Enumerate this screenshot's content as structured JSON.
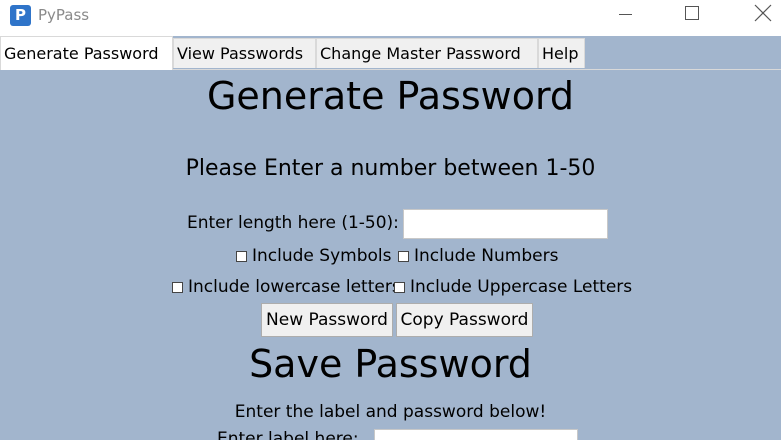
{
  "window": {
    "title": "PyPass",
    "icon_letter": "P",
    "icon_color": "#2f74c9",
    "background": "#a2b5cd",
    "controls": [
      "minimize-icon",
      "maximize-icon",
      "close-icon"
    ]
  },
  "tabs": [
    {
      "label": "Generate Password",
      "selected": true
    },
    {
      "label": "View Passwords",
      "selected": false
    },
    {
      "label": "Change Master Password",
      "selected": false
    },
    {
      "label": "Help",
      "selected": false
    }
  ],
  "generate": {
    "heading": "Generate Password",
    "instruction": "Please Enter a number between 1-50",
    "length_label": "Enter length here (1-50):",
    "length_value": "",
    "options": {
      "symbols": {
        "label": "Include Symbols",
        "checked": false
      },
      "numbers": {
        "label": "Include Numbers",
        "checked": false
      },
      "lowercase": {
        "label": "Include lowercase letters",
        "checked": false
      },
      "uppercase": {
        "label": "Include Uppercase Letters",
        "checked": false
      }
    },
    "new_button": "New Password",
    "copy_button": "Copy Password"
  },
  "save": {
    "heading": "Save Password",
    "instruction": "Enter the label and password below!",
    "label_label": "Enter label here:",
    "label_value": ""
  }
}
